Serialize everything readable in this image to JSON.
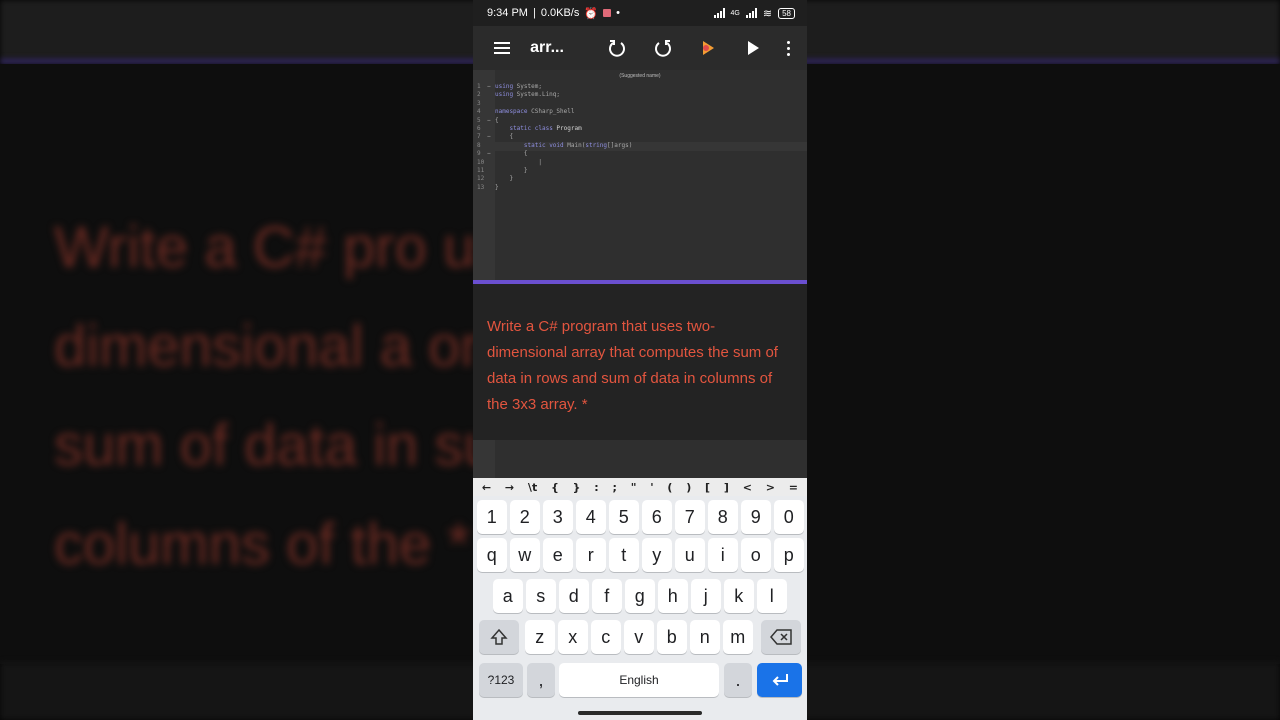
{
  "status": {
    "time": "9:34 PM",
    "speed": "0.0KB/s",
    "network": "4G",
    "battery": "58"
  },
  "toolbar": {
    "title": "arr..."
  },
  "editor": {
    "suggest": "(Suggested name)",
    "lines": [
      {
        "n": "1",
        "fold": "−",
        "parts": [
          {
            "t": "using",
            "c": "kw"
          },
          {
            "t": " System;",
            "c": ""
          }
        ]
      },
      {
        "n": "2",
        "fold": "",
        "parts": [
          {
            "t": "using",
            "c": "kw"
          },
          {
            "t": " System.Linq;",
            "c": ""
          }
        ]
      },
      {
        "n": "3",
        "fold": "",
        "parts": []
      },
      {
        "n": "4",
        "fold": "",
        "parts": [
          {
            "t": "namespace",
            "c": "kw"
          },
          {
            "t": " CSharp_Shell",
            "c": ""
          }
        ]
      },
      {
        "n": "5",
        "fold": "−",
        "parts": [
          {
            "t": "{",
            "c": ""
          }
        ]
      },
      {
        "n": "6",
        "fold": "",
        "parts": [
          {
            "t": "    ",
            "c": ""
          },
          {
            "t": "static class",
            "c": "kw"
          },
          {
            "t": " Program",
            "c": "cls"
          }
        ]
      },
      {
        "n": "7",
        "fold": "−",
        "parts": [
          {
            "t": "    {",
            "c": ""
          }
        ]
      },
      {
        "n": "8",
        "fold": "",
        "parts": [
          {
            "t": "        ",
            "c": ""
          },
          {
            "t": "static void",
            "c": "kw"
          },
          {
            "t": " Main(",
            "c": ""
          },
          {
            "t": "string",
            "c": "kw"
          },
          {
            "t": "[]args)",
            "c": ""
          }
        ]
      },
      {
        "n": "9",
        "fold": "−",
        "parts": [
          {
            "t": "        {",
            "c": ""
          }
        ]
      },
      {
        "n": "10",
        "fold": "",
        "parts": [
          {
            "t": "            |",
            "c": ""
          }
        ]
      },
      {
        "n": "11",
        "fold": "",
        "parts": [
          {
            "t": "        }",
            "c": ""
          }
        ]
      },
      {
        "n": "12",
        "fold": "",
        "parts": [
          {
            "t": "    }",
            "c": ""
          }
        ]
      },
      {
        "n": "13",
        "fold": "",
        "parts": [
          {
            "t": "}",
            "c": ""
          }
        ]
      }
    ]
  },
  "question": {
    "text": "Write a C# program that uses two-dimensional array that computes the sum of data in rows and sum of data in columns of the 3x3 array. *"
  },
  "symbols": [
    "←",
    "→",
    "\\t",
    "{",
    "}",
    ":",
    ";",
    "\"",
    "'",
    "(",
    ")",
    "[",
    "]",
    "<",
    ">",
    "="
  ],
  "keyboard": {
    "row_numbers": [
      "1",
      "2",
      "3",
      "4",
      "5",
      "6",
      "7",
      "8",
      "9",
      "0"
    ],
    "row_top": [
      "q",
      "w",
      "e",
      "r",
      "t",
      "y",
      "u",
      "i",
      "o",
      "p"
    ],
    "row_mid": [
      "a",
      "s",
      "d",
      "f",
      "g",
      "h",
      "j",
      "k",
      "l"
    ],
    "row_bottom": [
      "z",
      "x",
      "c",
      "v",
      "b",
      "n",
      "m"
    ],
    "mode_label": "?123",
    "comma": ",",
    "space_label": "English",
    "period": "."
  },
  "background": {
    "lines": [
      "Write a C# pro          uses two-",
      "dimensional a          omputes the",
      "sum of data in          sum of data in",
      "columns of the            *"
    ]
  },
  "colors": {
    "accent": "#6a4fd0",
    "question_text": "#e2553f",
    "enter_key": "#1a73e8"
  }
}
